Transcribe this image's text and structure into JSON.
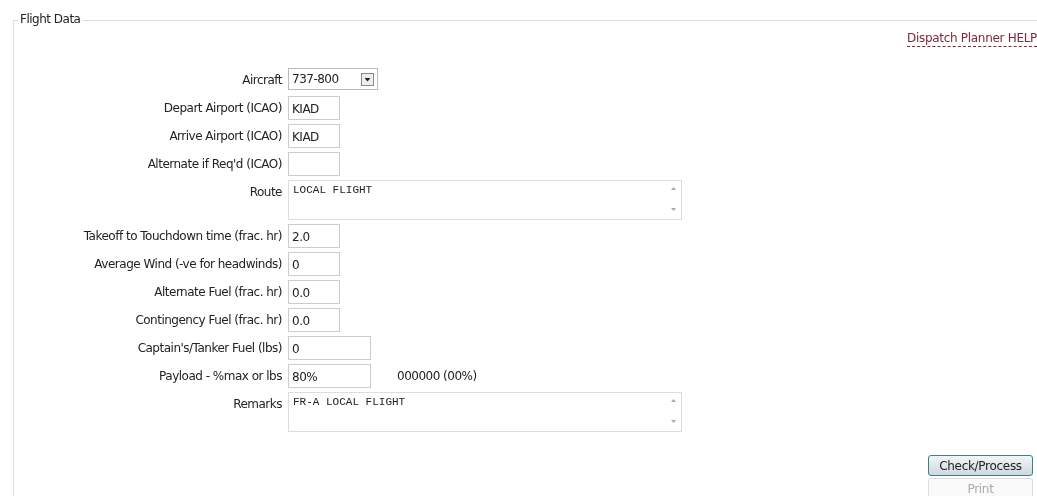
{
  "panel": {
    "title": "Flight Data"
  },
  "help_link": "Dispatch Planner HELP",
  "fields": [
    {
      "label": "Aircraft",
      "kind": "select",
      "value": "737-800"
    },
    {
      "label": "Depart Airport (ICAO)",
      "kind": "short",
      "value": "KIAD"
    },
    {
      "label": "Arrive Airport (ICAO)",
      "kind": "short",
      "value": "KIAD"
    },
    {
      "label": "Alternate if Req'd (ICAO)",
      "kind": "short"
    },
    {
      "label": "Route",
      "kind": "area",
      "value": "LOCAL FLIGHT"
    },
    {
      "label": "Takeoff to Touchdown time (frac. hr)",
      "kind": "short",
      "value": "2.0"
    },
    {
      "label": "Average Wind (-ve for headwinds)",
      "kind": "short",
      "value": "0"
    },
    {
      "label": "Alternate Fuel (frac. hr)",
      "kind": "short",
      "value": "0.0"
    },
    {
      "label": "Contingency Fuel (frac. hr)",
      "kind": "short",
      "value": "0.0"
    },
    {
      "label": "Captain's/Tanker Fuel (lbs)",
      "kind": "medium",
      "value": "0"
    },
    {
      "label": "Payload - %max or lbs",
      "kind": "medium",
      "value": "80%",
      "note": "000000 (00%)"
    },
    {
      "label": "Remarks",
      "kind": "area",
      "value": "FR-A LOCAL FLIGHT"
    }
  ],
  "buttons": [
    {
      "label": "Check/Process",
      "disabled": false
    },
    {
      "label": "Print",
      "disabled": true
    }
  ]
}
